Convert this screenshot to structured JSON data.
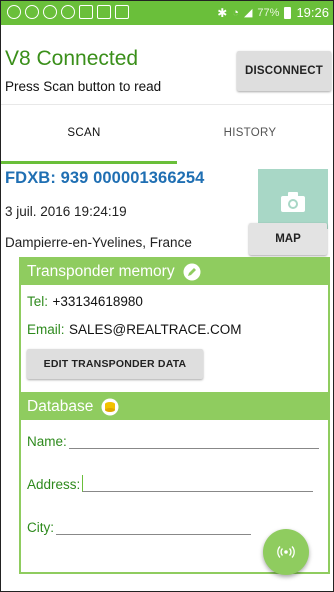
{
  "status_bar": {
    "battery": "77%",
    "time": "19:26"
  },
  "header": {
    "title": "V8 Connected",
    "subtitle": "Press Scan button to read",
    "disconnect_label": "DISCONNECT"
  },
  "tabs": [
    {
      "label": "SCAN",
      "active": true
    },
    {
      "label": "HISTORY",
      "active": false
    }
  ],
  "scan": {
    "code": "FDXB: 939 000001366254",
    "date": "3 juil. 2016 19:24:19",
    "location": "Dampierre-en-Yvelines, France",
    "map_label": "MAP"
  },
  "transponder": {
    "title": "Transponder memory",
    "tel_label": "Tel:",
    "tel_value": "+33134618980",
    "email_label": "Email:",
    "email_value": "SALES@REALTRACE.COM",
    "edit_label": "EDIT TRANSPONDER DATA"
  },
  "database": {
    "title": "Database",
    "name_label": "Name:",
    "address_label": "Address:",
    "city_label": "City:",
    "name_value": "",
    "address_value": "",
    "city_value": ""
  },
  "icons": {
    "edit": "pencil-icon",
    "database": "coins-icon",
    "camera": "camera-icon",
    "fab": "nfc-scan-icon"
  },
  "colors": {
    "accent": "#6abf3a",
    "section": "#8fcc5f",
    "code": "#1f6fb3",
    "label": "#2e8a1d"
  }
}
